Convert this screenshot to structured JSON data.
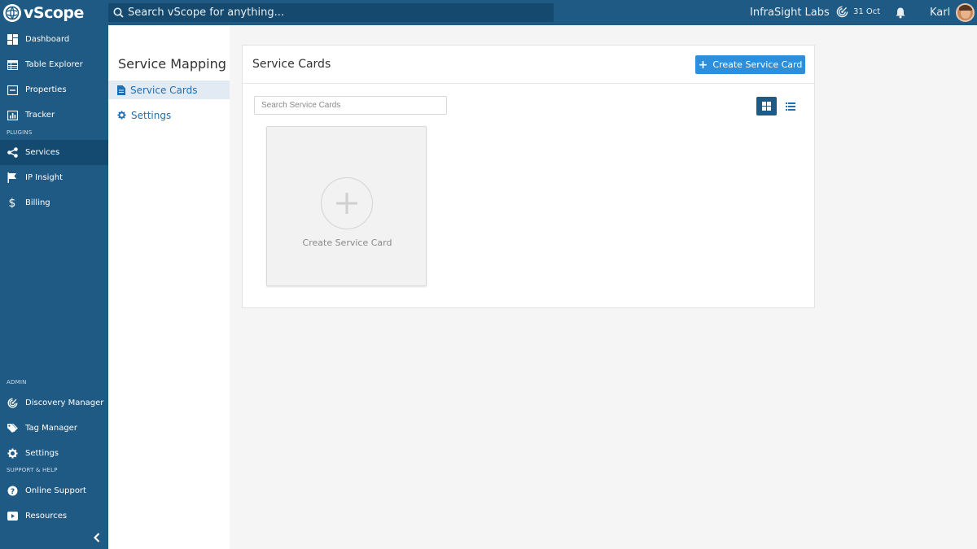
{
  "app": {
    "logo_text": "vScope"
  },
  "topbar": {
    "search_placeholder": "Search vScope for anything...",
    "organization": "InfraSight Labs",
    "date": "31 Oct",
    "user": "Karl"
  },
  "sidebar": {
    "items": [
      {
        "label": "Dashboard",
        "icon": "dashboard-icon"
      },
      {
        "label": "Table Explorer",
        "icon": "table-icon"
      },
      {
        "label": "Properties",
        "icon": "properties-icon"
      },
      {
        "label": "Tracker",
        "icon": "tracker-icon"
      }
    ],
    "plugins_label": "PLUGINS",
    "plugins": [
      {
        "label": "Services",
        "icon": "share-icon",
        "active": true
      },
      {
        "label": "IP Insight",
        "icon": "flag-icon"
      },
      {
        "label": "Billing",
        "icon": "dollar-icon"
      }
    ],
    "admin_label": "ADMIN",
    "admin": [
      {
        "label": "Discovery Manager",
        "icon": "discovery-icon"
      },
      {
        "label": "Tag Manager",
        "icon": "tags-icon"
      },
      {
        "label": "Settings",
        "icon": "gear-icon"
      }
    ],
    "support_label": "SUPPORT & HELP",
    "support": [
      {
        "label": "Online Support",
        "icon": "question-icon"
      },
      {
        "label": "Resources",
        "icon": "video-icon"
      }
    ]
  },
  "subnav": {
    "title": "Service Mapping",
    "items": [
      {
        "label": "Service Cards",
        "icon": "document-icon",
        "active": true
      },
      {
        "label": "Settings",
        "icon": "gear-icon"
      }
    ]
  },
  "main": {
    "title": "Service Cards",
    "create_button": "Create Service Card",
    "search_placeholder": "Search Service Cards",
    "create_card_label": "Create Service Card",
    "view_mode": "grid"
  },
  "colors": {
    "brand": "#1f5a85",
    "brand_dark": "#154a70",
    "accent": "#2d8fdb",
    "link": "#1f6fb3"
  }
}
